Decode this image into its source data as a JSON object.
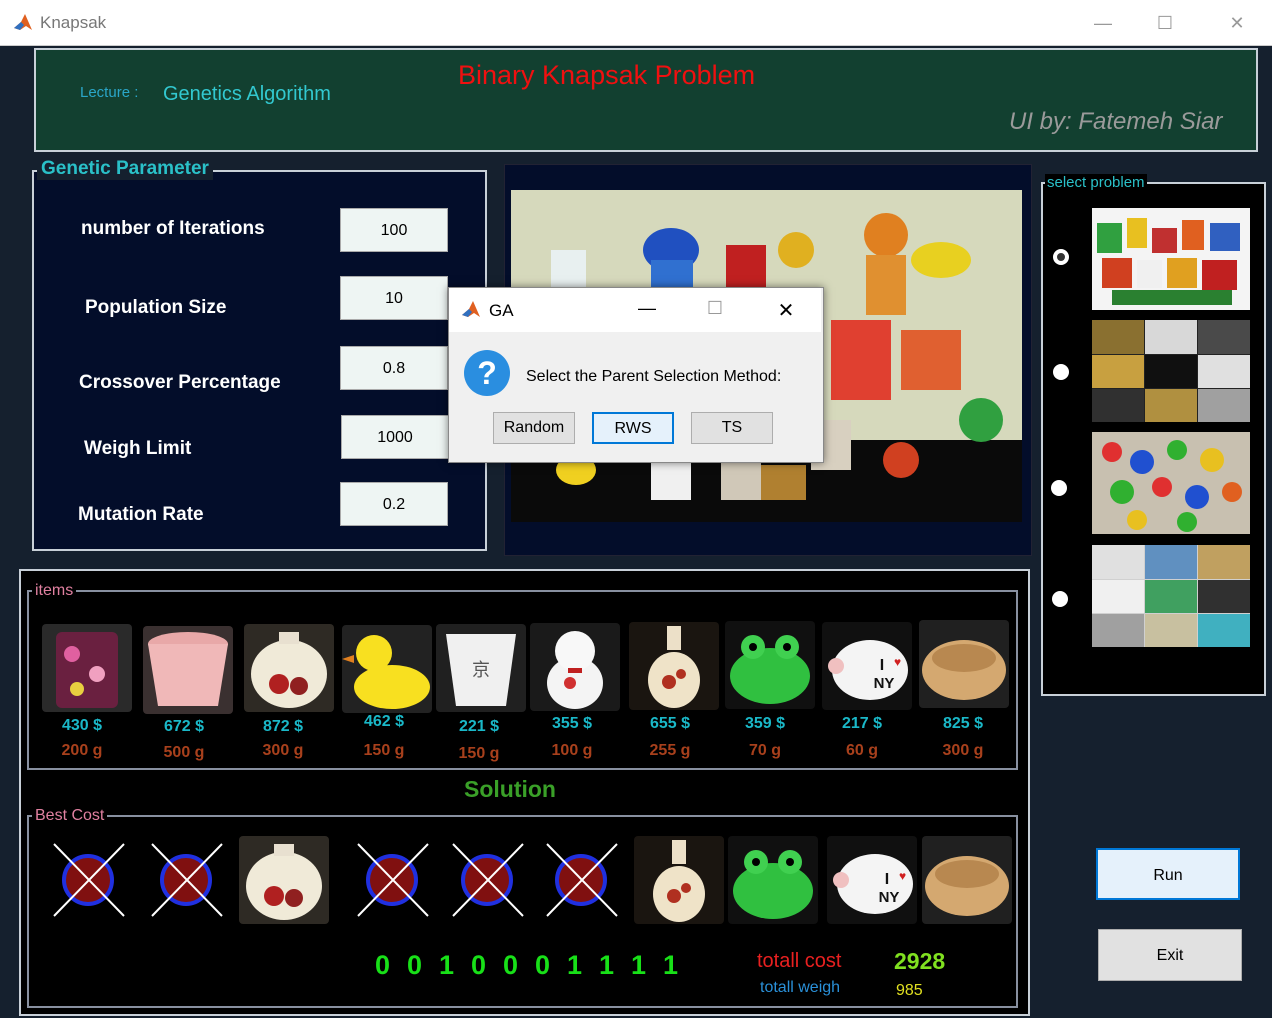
{
  "window": {
    "title": "Knapsak"
  },
  "header": {
    "lecture_label": "Lecture :",
    "lecture_value": "Genetics Algorithm",
    "title": "Binary Knapsak Problem",
    "credit": "UI by: Fatemeh Siar"
  },
  "genetic_parameter": {
    "title": "Genetic Parameter",
    "params": [
      {
        "label": "number of Iterations",
        "value": "100"
      },
      {
        "label": "Population Size",
        "value": "10"
      },
      {
        "label": "Crossover Percentage",
        "value": "0.8"
      },
      {
        "label": "Weigh Limit",
        "value": "1000"
      },
      {
        "label": "Mutation Rate",
        "value": "0.2"
      }
    ]
  },
  "select_problem": {
    "title": "select problem",
    "selected_index": 0,
    "options": [
      "toys",
      "jewelry",
      "puzzle-pieces",
      "accessories"
    ]
  },
  "items": {
    "title": "items",
    "list": [
      {
        "price": "430 $",
        "weight": "200 g",
        "icon": "floral-mug"
      },
      {
        "price": "672 $",
        "weight": "500 g",
        "icon": "pink-cup"
      },
      {
        "price": "872 $",
        "weight": "300 g",
        "icon": "floral-vase"
      },
      {
        "price": "462 $",
        "weight": "150 g",
        "icon": "rubber-duck"
      },
      {
        "price": "221 $",
        "weight": "150 g",
        "icon": "white-cup"
      },
      {
        "price": "355 $",
        "weight": "100 g",
        "icon": "lucky-cat"
      },
      {
        "price": "655 $",
        "weight": "255 g",
        "icon": "bud-vase"
      },
      {
        "price": "359 $",
        "weight": "70  g",
        "icon": "frog"
      },
      {
        "price": "217 $",
        "weight": "60  g",
        "icon": "piggy-bank"
      },
      {
        "price": "825 $",
        "weight": "300 g",
        "icon": "clay-bowl"
      }
    ]
  },
  "solution": {
    "title": "Solution",
    "best_cost_label": "Best Cost",
    "bits": [
      "0",
      "0",
      "1",
      "0",
      "0",
      "0",
      "1",
      "1",
      "1",
      "1"
    ],
    "total_cost_label": "totall cost",
    "total_cost_value": "2928",
    "total_weigh_label": "totall weigh",
    "total_weigh_value": "985"
  },
  "buttons": {
    "run": "Run",
    "exit": "Exit"
  },
  "dialog": {
    "title": "GA",
    "message": "Select the Parent Selection Method:",
    "options": [
      "Random",
      "RWS",
      "TS"
    ],
    "focused": "RWS"
  },
  "colors": {
    "header_bg": "#124030",
    "title_red": "#f01010",
    "bits_green": "#18e018"
  }
}
